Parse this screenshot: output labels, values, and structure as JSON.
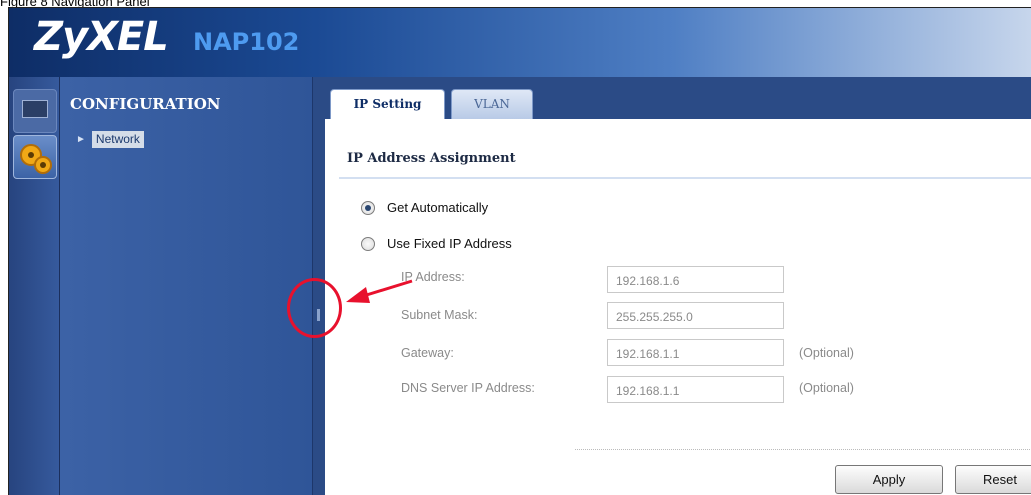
{
  "caption": "Figure 8 Navigation Panel",
  "header": {
    "brand": "ZyXEL",
    "model": "NAP102"
  },
  "iconbar": {
    "items": [
      {
        "icon": "monitor-icon"
      },
      {
        "icon": "gears-icon"
      }
    ]
  },
  "menu": {
    "title": "CONFIGURATION",
    "items": [
      {
        "label": "Network"
      }
    ]
  },
  "tabs": [
    {
      "label": "IP Setting",
      "active": true
    },
    {
      "label": "VLAN",
      "active": false
    }
  ],
  "section": {
    "title": "IP Address Assignment"
  },
  "assignment": {
    "options": [
      {
        "label": "Get Automatically",
        "checked": true
      },
      {
        "label": "Use Fixed IP Address",
        "checked": false
      }
    ]
  },
  "fields": [
    {
      "label": "IP Address:",
      "value": "192.168.1.6",
      "note": ""
    },
    {
      "label": "Subnet Mask:",
      "value": "255.255.255.0",
      "note": ""
    },
    {
      "label": "Gateway:",
      "value": "192.168.1.1",
      "note": "(Optional)"
    },
    {
      "label": "DNS Server IP Address:",
      "value": "192.168.1.1",
      "note": "(Optional)"
    }
  ],
  "buttons": {
    "apply": "Apply",
    "reset": "Reset"
  },
  "colors": {
    "header_dark": "#0e2d66",
    "menu_bg": "#3c62a6",
    "model_blue": "#4e9bf0",
    "callout_red": "#e8112d"
  }
}
